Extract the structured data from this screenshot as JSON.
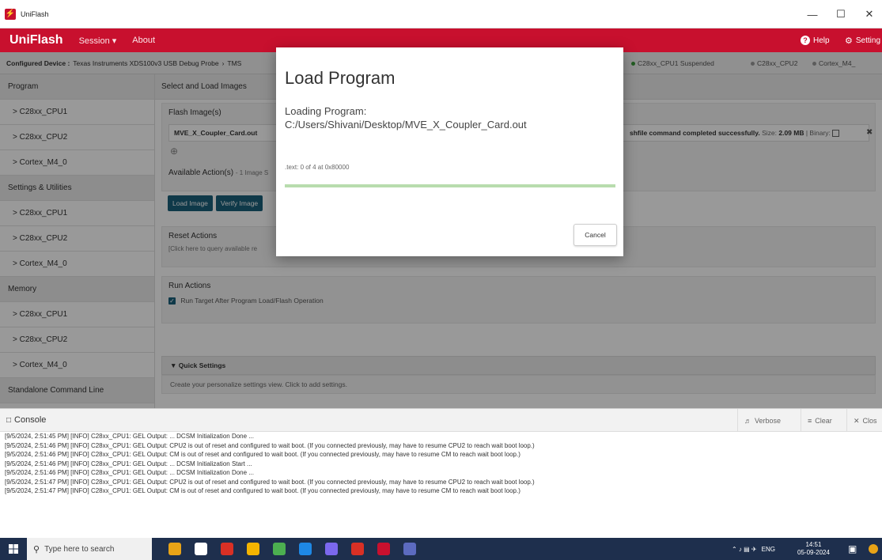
{
  "window": {
    "title": "UniFlash",
    "logo_letter": "⚡"
  },
  "appbar": {
    "brand": "UniFlash",
    "menu_session": "Session ▾",
    "menu_about": "About",
    "help_label": "Help",
    "settings_label": "Setting"
  },
  "config": {
    "label": "Configured Device :",
    "device": "Texas Instruments XDS100v3 USB Debug Probe",
    "separator": "›",
    "target": "TMS",
    "cores": [
      {
        "label": "C28xx_CPU1 Suspended",
        "color": "#3a9a3a"
      },
      {
        "label": "C28xx_CPU2",
        "color": "#9a9a9a"
      },
      {
        "label": "Cortex_M4_",
        "color": "#9a9a9a"
      }
    ]
  },
  "sidebar": {
    "rows": [
      {
        "label": "Program",
        "type": "header"
      },
      {
        "label": "> C28xx_CPU1",
        "type": "item"
      },
      {
        "label": "> C28xx_CPU2",
        "type": "item"
      },
      {
        "label": "> Cortex_M4_0",
        "type": "item"
      },
      {
        "label": "Settings & Utilities",
        "type": "header"
      },
      {
        "label": "> C28xx_CPU1",
        "type": "item"
      },
      {
        "label": "> C28xx_CPU2",
        "type": "item"
      },
      {
        "label": "> Cortex_M4_0",
        "type": "item"
      },
      {
        "label": "Memory",
        "type": "header"
      },
      {
        "label": "> C28xx_CPU1",
        "type": "item"
      },
      {
        "label": "> C28xx_CPU2",
        "type": "item"
      },
      {
        "label": "> Cortex_M4_0",
        "type": "item"
      },
      {
        "label": "Standalone Command Line",
        "type": "header"
      }
    ]
  },
  "main": {
    "section_title": "Select and Load Images",
    "flash_title": "Flash Image(s)",
    "flash_file": "MVE_X_Coupler_Card.out",
    "flash_result_text": "shfile command completed successfully.",
    "flash_size_label": "Size:",
    "flash_size": "2.09 MB",
    "flash_binary_label": "| Binary:",
    "add_icon": "⊕",
    "remove_icon": "✖",
    "actions_title": "Available Action(s)",
    "actions_sub": "- 1 Image S",
    "load_button": "Load Image",
    "verify_button": "Verify Image",
    "reset_title": "Reset Actions",
    "reset_hint": "[Click here to query available re",
    "run_title": "Run Actions",
    "run_option": "Run Target After Program Load/Flash Operation",
    "quick_title": "▼  Quick Settings",
    "quick_hint": "Create your personalize settings view. Click to add settings."
  },
  "console": {
    "title": "Console",
    "verbose": "Verbose",
    "clear": "Clear",
    "close": "Clos",
    "lines": [
      "[9/5/2024, 2:51:45 PM] [INFO] C28xx_CPU1: GEL Output: ... DCSM Initialization Done ...",
      "[9/5/2024, 2:51:46 PM] [INFO] C28xx_CPU1: GEL Output: CPU2 is out of reset and configured to wait boot. (If you connected previously, may have to resume CPU2 to reach wait boot loop.)",
      "[9/5/2024, 2:51:46 PM] [INFO] C28xx_CPU1: GEL Output: CM is out of reset and configured to wait boot. (If you connected previously, may have to resume CM to reach wait boot loop.)",
      "[9/5/2024, 2:51:46 PM] [INFO] C28xx_CPU1: GEL Output: ... DCSM Initialization Start ...",
      "[9/5/2024, 2:51:46 PM] [INFO] C28xx_CPU1: GEL Output: ... DCSM Initialization Done ...",
      "[9/5/2024, 2:51:47 PM] [INFO] C28xx_CPU1: GEL Output: CPU2 is out of reset and configured to wait boot. (If you connected previously, may have to resume CPU2 to reach wait boot loop.)",
      "[9/5/2024, 2:51:47 PM] [INFO] C28xx_CPU1: GEL Output: CM is out of reset and configured to wait boot. (If you connected previously, may have to resume CM to reach wait boot loop.)"
    ]
  },
  "modal": {
    "title": "Load Program",
    "loading_label": "Loading Program:",
    "path": "C:/Users/Shivani/Desktop/MVE_X_Coupler_Card.out",
    "status": ".text: 0 of 4 at 0x80000",
    "progress": 1.0,
    "cancel": "Cancel"
  },
  "taskbar": {
    "search_placeholder": "Type here to search",
    "lang": "ENG",
    "time": "14:51",
    "date": "05-09-2024",
    "icon_colors": [
      "#e8a317",
      "#ffffff",
      "#d93025",
      "#f4b400",
      "#4caf50",
      "#1e88e5",
      "#7b68ee",
      "#d93025",
      "#c8102e",
      "#5c6bc0"
    ]
  }
}
